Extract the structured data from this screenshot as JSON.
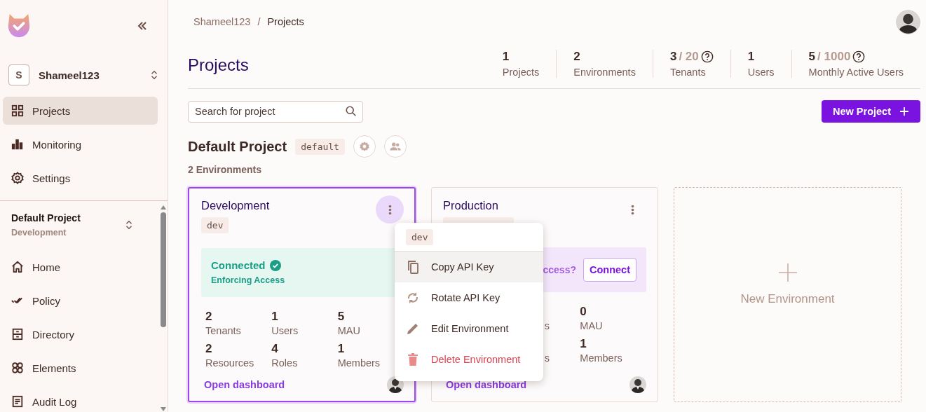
{
  "sidebar": {
    "org": {
      "initial": "S",
      "name": "Shameel123"
    },
    "nav": [
      {
        "label": "Projects",
        "selected": true
      },
      {
        "label": "Monitoring",
        "selected": false
      },
      {
        "label": "Settings",
        "selected": false
      }
    ],
    "project_switcher": {
      "project": "Default Project",
      "environment": "Development"
    },
    "project_nav": [
      {
        "label": "Home",
        "selected": false
      },
      {
        "label": "Policy",
        "selected": false
      },
      {
        "label": "Directory",
        "selected": false
      },
      {
        "label": "Elements",
        "selected": false
      },
      {
        "label": "Audit Log",
        "selected": false
      }
    ]
  },
  "breadcrumb": [
    "Shameel123",
    "/",
    "Projects"
  ],
  "title": "Projects",
  "stats": [
    {
      "value": "1",
      "label": "Projects"
    },
    {
      "value": "2",
      "label": "Environments"
    },
    {
      "value": "3",
      "total": "/ 20",
      "label": "Tenants",
      "help": true
    },
    {
      "value": "1",
      "label": "Users"
    },
    {
      "value": "5",
      "total": "/ 1000",
      "label": "Monthly Active Users",
      "help": true
    }
  ],
  "search": {
    "placeholder": "Search for project"
  },
  "new_project_button": "New Project",
  "project": {
    "name": "Default Project",
    "tag": "default",
    "environment_count": "2 Environments"
  },
  "environments": [
    {
      "name": "Development",
      "tag": "dev",
      "selected": true,
      "kind": "connected",
      "status_label": "Connected",
      "status_detail": "Enforcing Access",
      "stats": [
        {
          "value": "2",
          "label": "Tenants"
        },
        {
          "value": "1",
          "label": "Users"
        },
        {
          "value": "5",
          "label": "MAU"
        },
        {
          "value": "2",
          "label": "Resources"
        },
        {
          "value": "4",
          "label": "Roles"
        },
        {
          "value": "1",
          "label": "Members"
        }
      ],
      "link": "Open dashboard"
    },
    {
      "name": "Production",
      "selected": false,
      "kind": "not_connected",
      "prompt": "ccess?",
      "connect_button": "Connect",
      "stats": [
        {
          "label": "s"
        },
        {
          "value": "0",
          "label": "MAU"
        },
        {
          "label": "s"
        },
        {
          "value": "1",
          "label": "Members"
        }
      ],
      "link": "Open dashboard"
    }
  ],
  "new_environment": "New Environment",
  "menu": {
    "tag": "dev",
    "items": [
      {
        "label": "Copy API Key",
        "kind": "normal",
        "selected": true
      },
      {
        "label": "Rotate API Key",
        "kind": "normal",
        "selected": false
      },
      {
        "label": "Edit Environment",
        "kind": "normal",
        "selected": false
      },
      {
        "label": "Delete Environment",
        "kind": "danger",
        "selected": false
      }
    ]
  }
}
